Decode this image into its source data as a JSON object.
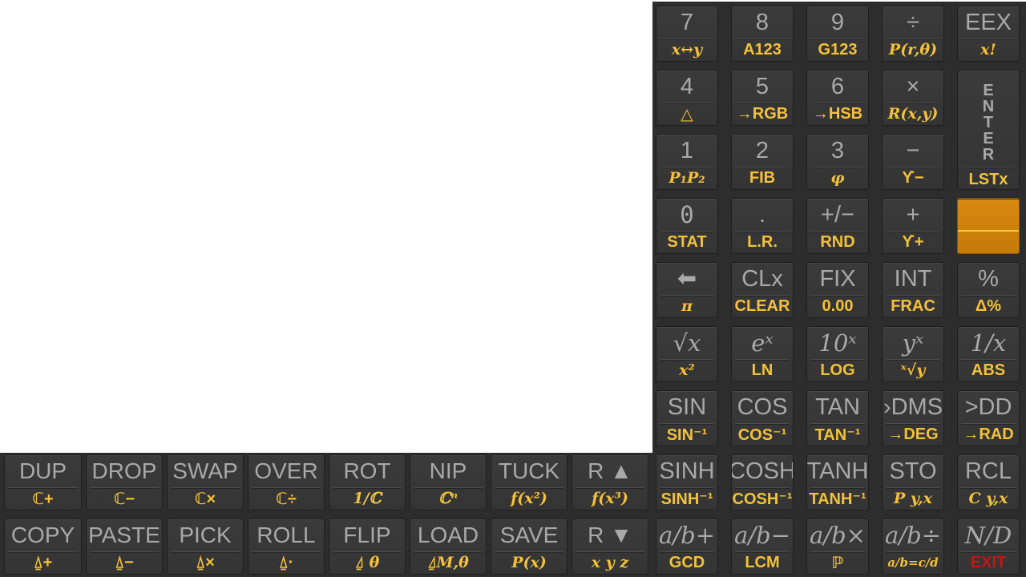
{
  "right_keys": [
    {
      "main": "7",
      "shift": "x↔y",
      "style": "serif"
    },
    {
      "main": "8",
      "shift": "A123"
    },
    {
      "main": "9",
      "shift": "G123"
    },
    {
      "main": "÷",
      "shift": "P(r,θ)",
      "style": "serif"
    },
    {
      "main": "EEX",
      "shift": "x!",
      "style": "serif"
    },
    {
      "main": "4",
      "shift": "△"
    },
    {
      "main": "5",
      "shift": "→RGB"
    },
    {
      "main": "6",
      "shift": "→HSB"
    },
    {
      "main": "×",
      "shift": "R(x,y)",
      "style": "serif"
    },
    {
      "main": "E N T E R",
      "shift": "LSTx"
    },
    {
      "main": "1",
      "shift": "P₁P₂",
      "style": "serif"
    },
    {
      "main": "2",
      "shift": "FIB"
    },
    {
      "main": "3",
      "shift": "φ",
      "style": "serif"
    },
    {
      "main": "−",
      "shift": "ϒ−"
    },
    {
      "main": "0",
      "shift": "STAT",
      "style_main": "mono"
    },
    {
      "main": ".",
      "shift": "L.R."
    },
    {
      "main": "+/−",
      "shift": "RND"
    },
    {
      "main": "+",
      "shift": "ϒ+"
    },
    {
      "main": "",
      "shift": ""
    },
    {
      "main": "⬅",
      "shift": "π",
      "style": "serif"
    },
    {
      "main": "CLx",
      "shift": "CLEAR"
    },
    {
      "main": "FIX",
      "shift": "0.00"
    },
    {
      "main": "INT",
      "shift": "FRAC"
    },
    {
      "main": "%",
      "shift": "Δ%"
    },
    {
      "main": "√x",
      "shift": "x²",
      "style": "serif",
      "style_main": "serif"
    },
    {
      "main": "eˣ",
      "shift": "LN",
      "style_main": "serif"
    },
    {
      "main": "10ˣ",
      "shift": "LOG",
      "style_main": "serif"
    },
    {
      "main": "yˣ",
      "shift": "ˣ√y",
      "style": "serif",
      "style_main": "serif"
    },
    {
      "main": "1/x",
      "shift": "ABS",
      "style_main": "serif"
    },
    {
      "main": "SIN",
      "shift": "SIN⁻¹"
    },
    {
      "main": "COS",
      "shift": "COS⁻¹"
    },
    {
      "main": "TAN",
      "shift": "TAN⁻¹"
    },
    {
      "main": "›DMS",
      "shift": "→DEG"
    },
    {
      "main": ">DD",
      "shift": "→RAD"
    },
    {
      "main": "SINH",
      "shift": "SINH⁻¹"
    },
    {
      "main": "COSH",
      "shift": "COSH⁻¹"
    },
    {
      "main": "TANH",
      "shift": "TANH⁻¹"
    },
    {
      "main": "STO",
      "shift": "P y,x",
      "style": "serif"
    },
    {
      "main": "RCL",
      "shift": "C y,x",
      "style": "serif"
    },
    {
      "main": "a/b+",
      "shift": "GCD",
      "style_main": "serif"
    },
    {
      "main": "a/b−",
      "shift": "LCM",
      "style_main": "serif"
    },
    {
      "main": "a/b×",
      "shift": "ℙ",
      "style_main": "serif"
    },
    {
      "main": "a/b÷",
      "shift": "a/b=c/d",
      "style": "serif",
      "style_main": "serif"
    },
    {
      "main": "N/D",
      "shift": "EXIT",
      "style_main": "serif"
    }
  ],
  "bottom_keys": [
    {
      "main": "DUP",
      "shift": "ℂ+"
    },
    {
      "main": "DROP",
      "shift": "ℂ−"
    },
    {
      "main": "SWAP",
      "shift": "ℂ×"
    },
    {
      "main": "OVER",
      "shift": "ℂ÷"
    },
    {
      "main": "ROT",
      "shift": "1/ℂ",
      "style": "serif"
    },
    {
      "main": "NIP",
      "shift": "ℂⁿ",
      "style": "serif"
    },
    {
      "main": "TUCK",
      "shift": "f(x²)",
      "style": "serif"
    },
    {
      "main": "R ▲",
      "shift": "f(x³)",
      "style": "serif"
    },
    {
      "main": "COPY",
      "shift": "⍙+"
    },
    {
      "main": "PASTE",
      "shift": "⍙−"
    },
    {
      "main": "PICK",
      "shift": "⍙×"
    },
    {
      "main": "ROLL",
      "shift": "⍙·"
    },
    {
      "main": "FLIP",
      "shift": "⍙ θ",
      "style": "serif"
    },
    {
      "main": "LOAD",
      "shift": "⍙M,θ",
      "style": "serif"
    },
    {
      "main": "SAVE",
      "shift": "P(x)",
      "style": "serif"
    },
    {
      "main": "R ▼",
      "shift": "x y z",
      "style": "serif"
    }
  ],
  "colors": {
    "panel": "#2d2d2d",
    "key": "#383838",
    "main_text": "#a9a9a9",
    "shift_text": "#f3c13a",
    "shift_key": "#d88a10",
    "exit_text": "#c81414"
  }
}
